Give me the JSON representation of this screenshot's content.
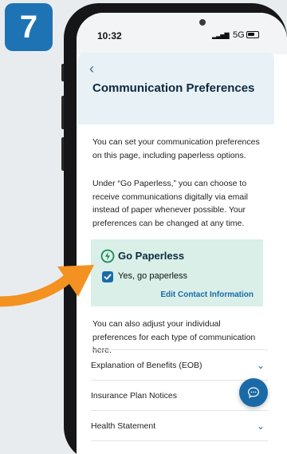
{
  "step": {
    "number": "7"
  },
  "status_bar": {
    "time": "10:32",
    "network": "5G",
    "signal_glyph": "▂▃▅▇"
  },
  "header": {
    "back_glyph": "‹",
    "title": "Communication Preferences"
  },
  "intro": {
    "paragraph1": "You can set your communication preferences on this page, including paperless options.",
    "paragraph2": "Under “Go Paperless,” you can choose to receive communications digitally via email instead of paper whenever possible. Your preferences can be changed at any time."
  },
  "paperless": {
    "title": "Go Paperless",
    "checkbox_label": "Yes, go paperless",
    "checked": true,
    "edit_link": "Edit Contact Information"
  },
  "adjust_text": "You can also adjust your individual preferences for each type of communication here.",
  "list": [
    {
      "label": "Explanation of Benefits (EOB)"
    },
    {
      "label": "Insurance Plan Notices"
    },
    {
      "label": "Health Statement"
    }
  ],
  "colors": {
    "accent": "#1b6aa8",
    "badge": "#1e73b5",
    "paperless_bg": "#d9efe8",
    "arrow": "#f39221"
  }
}
